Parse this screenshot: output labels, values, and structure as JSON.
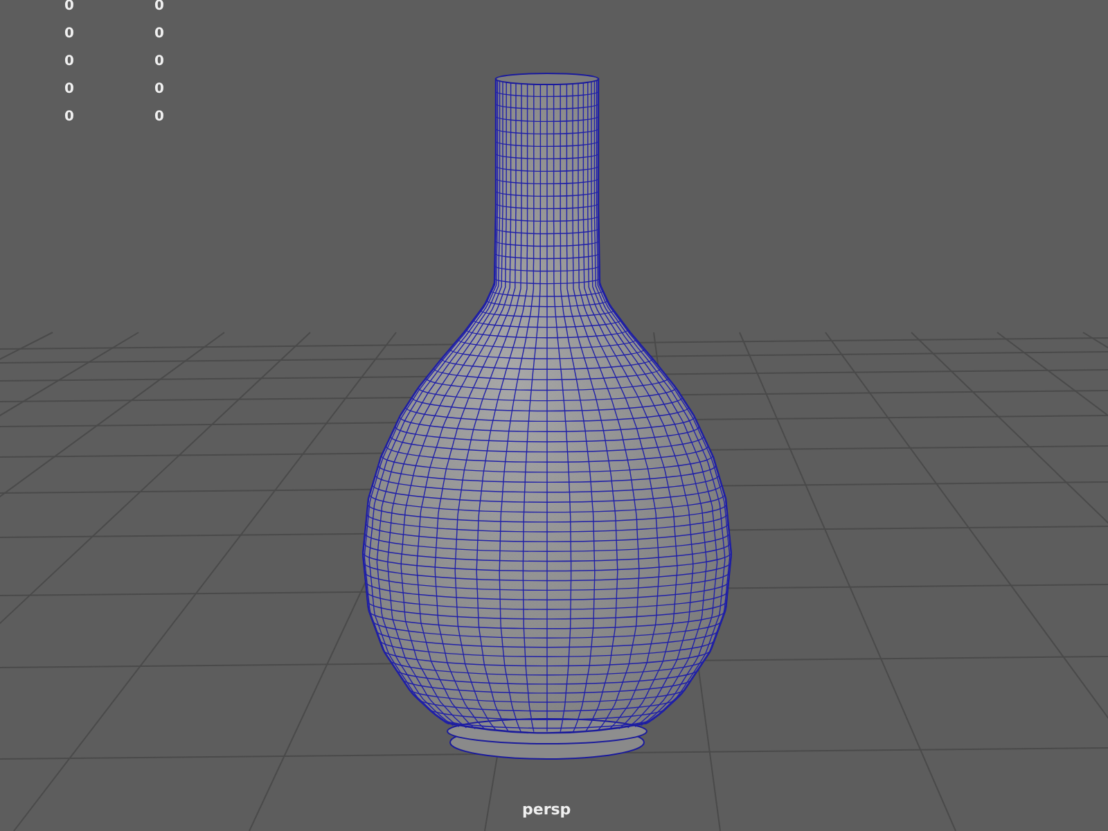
{
  "stats": [
    {
      "column_1": "0",
      "column_2": "0"
    },
    {
      "column_1": "0",
      "column_2": "0"
    },
    {
      "column_1": "0",
      "column_2": "0"
    },
    {
      "column_1": "0",
      "column_2": "0"
    },
    {
      "column_1": "0",
      "column_2": "0"
    }
  ],
  "camera": {
    "label": "persp"
  }
}
